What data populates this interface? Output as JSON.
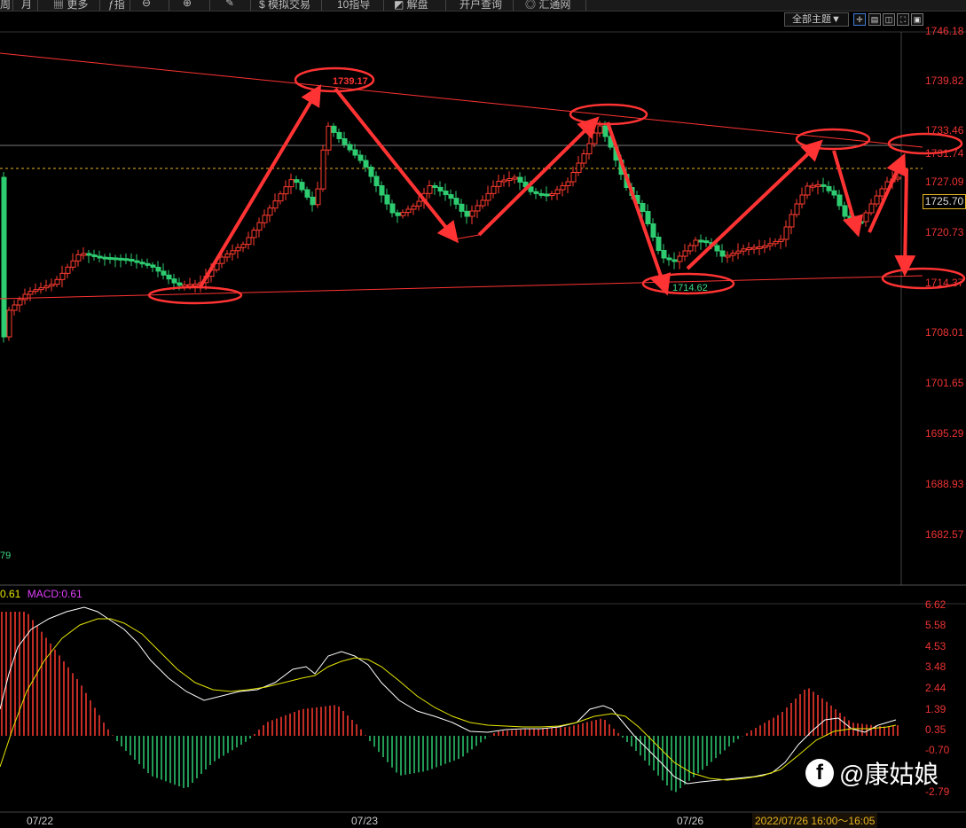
{
  "toolbar": {
    "items": [
      "周",
      "月",
      "更多",
      "指",
      "",
      "",
      "模拟交易",
      "10指导",
      "解盘",
      "开户查询",
      "汇通网"
    ]
  },
  "controls": {
    "topic_label": "全部主题▼"
  },
  "price_axis": {
    "labels": [
      "1746.18",
      "1739.82",
      "1733.46",
      "1731.74",
      "1727.09",
      "1720.73",
      "1714.37",
      "1708.01",
      "1701.65",
      "1695.29",
      "1688.93",
      "1682.57"
    ],
    "current_price": "1725.70"
  },
  "annotations": {
    "high_label": "1739.17",
    "low_label": "1714.62"
  },
  "left_value": "79",
  "macd": {
    "diff_label": "0.61",
    "macd_label": "MACD:0.61",
    "axis_labels": [
      "6.62",
      "5.58",
      "4.53",
      "3.48",
      "2.44",
      "1.39",
      "0.35",
      "-0.70",
      "-2.79"
    ]
  },
  "dates": [
    "07/22",
    "07/23",
    "07/26"
  ],
  "time_range": "2022/07/26 16:00～16:05",
  "watermark": "@康姑娘",
  "colors": {
    "up": "#ff3b30",
    "down": "#2ecc71",
    "axis_text": "#e33333",
    "annotation": "#ff3333",
    "dif_line": "#ffffff",
    "dea_line": "#e6e600",
    "macd_label": "#e040fb",
    "guide_dotted": "#e6b422"
  }
}
